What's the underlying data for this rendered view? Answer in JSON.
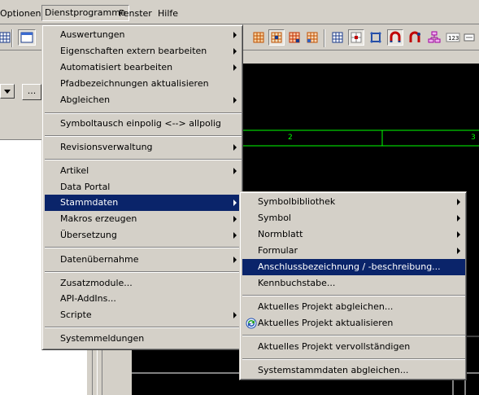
{
  "menubar": {
    "items": [
      "Optionen",
      "Dienstprogramme",
      "Fenster",
      "Hilfe"
    ]
  },
  "toolbar": {
    "icons": [
      "grid-icon",
      "window-icon",
      "cell-orange-icon",
      "cell-pressed-icon",
      "cell-red-icon",
      "cell-blue-icon",
      "grid-blue-icon",
      "target-icon",
      "frame-icon",
      "magnet-icon",
      "magnet-red-icon",
      "chart-icon",
      "t-label-icon",
      "box-icon",
      "arrow-icon"
    ]
  },
  "leftpanel": {
    "ellipsis_label": "..."
  },
  "canvas": {
    "column_labels": [
      "2",
      "3"
    ]
  },
  "menu_dienst": {
    "items": [
      {
        "label": "Auswertungen",
        "submenu": true
      },
      {
        "label": "Eigenschaften extern bearbeiten",
        "submenu": true
      },
      {
        "label": "Automatisiert bearbeiten",
        "submenu": true
      },
      {
        "label": "Pfadbezeichnungen aktualisieren",
        "submenu": false
      },
      {
        "label": "Abgleichen",
        "submenu": true
      },
      {
        "label": "Symboltausch einpolig <--> allpolig",
        "submenu": false
      },
      {
        "label": "Revisionsverwaltung",
        "submenu": true
      },
      {
        "label": "Artikel",
        "submenu": true
      },
      {
        "label": "Data Portal",
        "submenu": false
      },
      {
        "label": "Stammdaten",
        "submenu": true
      },
      {
        "label": "Makros erzeugen",
        "submenu": true
      },
      {
        "label": "Übersetzung",
        "submenu": true
      },
      {
        "label": "Datenübernahme",
        "submenu": true
      },
      {
        "label": "Zusatzmodule...",
        "submenu": false
      },
      {
        "label": "API-AddIns...",
        "submenu": false
      },
      {
        "label": "Scripte",
        "submenu": true
      },
      {
        "label": "Systemmeldungen",
        "submenu": false
      }
    ]
  },
  "menu_stamm": {
    "items": [
      {
        "label": "Symbolbibliothek",
        "submenu": true
      },
      {
        "label": "Symbol",
        "submenu": true
      },
      {
        "label": "Normblatt",
        "submenu": true
      },
      {
        "label": "Formular",
        "submenu": true
      },
      {
        "label": "Anschlussbezeichnung / -beschreibung...",
        "submenu": false
      },
      {
        "label": "Kennbuchstabe...",
        "submenu": false
      },
      {
        "label": "Aktuelles Projekt abgleichen...",
        "submenu": false
      },
      {
        "label": "Aktuelles Projekt aktualisieren",
        "submenu": false
      },
      {
        "label": "Aktuelles Projekt vervollständigen",
        "submenu": false
      },
      {
        "label": "Systemstammdaten abgleichen...",
        "submenu": false
      }
    ]
  },
  "colors": {
    "highlight": "#0a246a",
    "canvas_bg": "#000000",
    "grid_line": "#00ff00",
    "face": "#d4d0c8"
  }
}
